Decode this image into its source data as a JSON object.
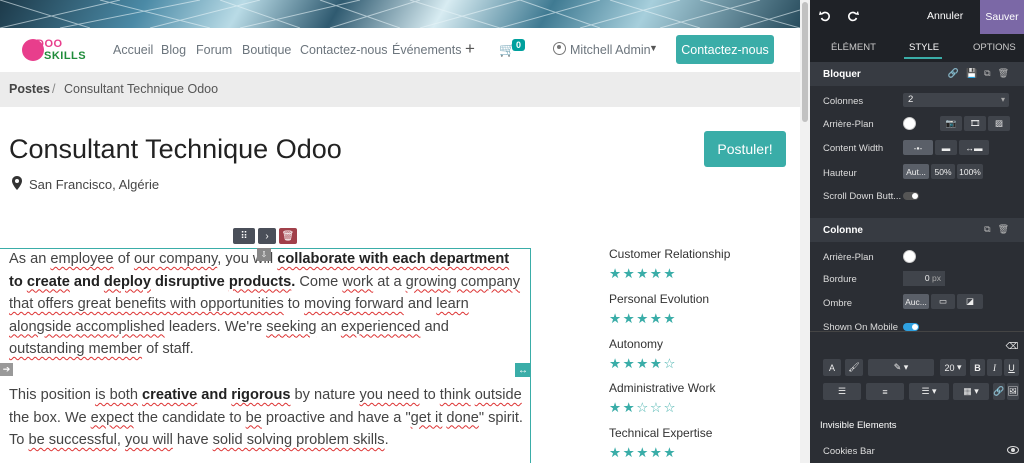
{
  "navbar": {
    "logo_top": "DOO",
    "logo_bottom": "SKILLS",
    "links": [
      "Accueil",
      "Blog",
      "Forum",
      "Boutique",
      "Contactez-nous",
      "Événements"
    ],
    "plus": "+",
    "cart_count": "0",
    "user": "Mitchell Admin",
    "cta": "Contactez-nous"
  },
  "breadcrumb": {
    "home": "Postes",
    "sep": "/",
    "current": "Consultant Technique Odoo"
  },
  "job": {
    "title": "Consultant Technique Odoo",
    "location": "San Francisco, Algérie",
    "apply": "Postuler!"
  },
  "skills": [
    {
      "name": "Customer Relationship",
      "rating": 5
    },
    {
      "name": "Personal Evolution",
      "rating": 5
    },
    {
      "name": "Autonomy",
      "rating": 4
    },
    {
      "name": "Administrative Work",
      "rating": 2
    },
    {
      "name": "Technical Expertise",
      "rating": 5
    }
  ],
  "panel": {
    "cancel": "Annuler",
    "save": "Sauver",
    "tabs": {
      "element": "ÉLÉMENT",
      "style": "STYLE",
      "options": "OPTIONS"
    },
    "block": {
      "title": "Bloquer",
      "columns_label": "Colonnes",
      "columns_value": "2",
      "background_label": "Arrière-Plan",
      "content_width_label": "Content Width",
      "height_label": "Hauteur",
      "height_opts": [
        "Aut...",
        "50%",
        "100%"
      ],
      "scroll_label": "Scroll Down Butt..."
    },
    "column": {
      "title": "Colonne",
      "background_label": "Arrière-Plan",
      "border_label": "Bordure",
      "border_value": "0",
      "border_unit": "px",
      "shadow_label": "Ombre",
      "shadow_value": "Auc...",
      "mobile_label": "Shown On Mobile"
    },
    "font_size": "20",
    "invisible_title": "Invisible Elements",
    "cookies": "Cookies Bar"
  }
}
